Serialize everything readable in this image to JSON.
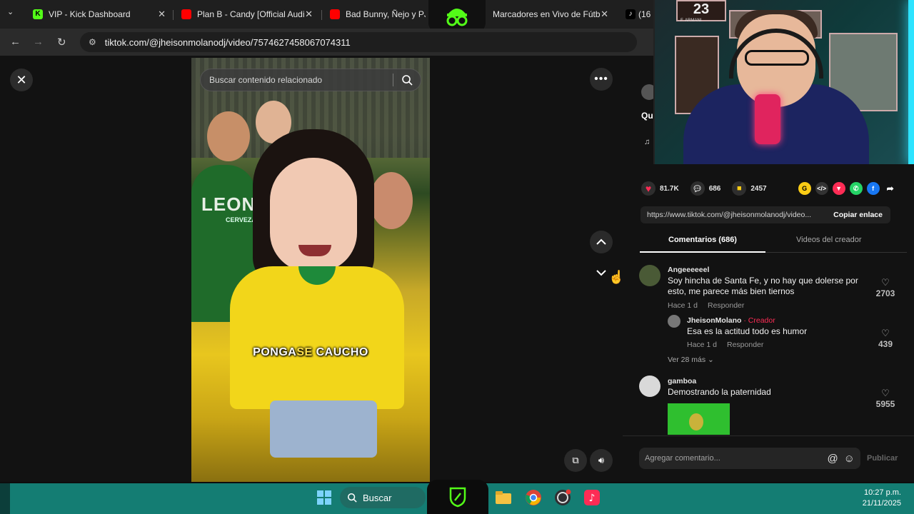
{
  "browser": {
    "tabs": [
      {
        "label": "VIP - Kick Dashboard",
        "favicon_color": "#53fc18"
      },
      {
        "label": "Plan B - Candy [Official Audi",
        "favicon_color": "#ff0000"
      },
      {
        "label": "Bad Bunny, Ñejo y PJ S",
        "favicon_color": "#ff0000"
      },
      {
        "label": "Marcadores en Vivo de Fútb",
        "favicon_color": "#1a1a1a"
      },
      {
        "label": "(16",
        "favicon_color": "#000000"
      }
    ],
    "tab_close_symbol": "✕",
    "url": "tiktok.com/@jheisonmolanodj/video/7574627458067074311"
  },
  "video": {
    "search_placeholder": "Buscar contenido relacionado",
    "caption_white": "PONGA",
    "caption_yellow": "SE",
    "caption_rest": " CAUCHO",
    "jersey_text": "LEON",
    "jersey_sub": "CERVEZA"
  },
  "webcam": {
    "shirt_number": "23",
    "frame_label": "F. ARMANI"
  },
  "stats": {
    "likes": "81.7K",
    "comments": "686",
    "saves": "2457"
  },
  "share": {
    "link": "https://www.tiktok.com/@jheisonmolanodj/video...",
    "copy_label": "Copiar enlace"
  },
  "partial_info": {
    "title_fragment": "Qu"
  },
  "tabs": {
    "comments": "Comentarios (686)",
    "creator_videos": "Videos del creador"
  },
  "comments": [
    {
      "user": "Angeeeeeel",
      "text": "Soy hincha de Santa Fe, y no hay que dolerse por esto, me parece más bien tiernos",
      "time": "Hace 1 d",
      "reply": "Responder",
      "likes": "2703"
    },
    {
      "user": "JheisonMolano",
      "badge": "· Creador",
      "text": "Esa es la actitud todo es humor",
      "time": "Hace 1 d",
      "reply": "Responder",
      "likes": "439"
    },
    {
      "user": "gamboa",
      "text": "Demostrando la paternidad",
      "likes": "5955"
    }
  ],
  "more_replies": "Ver 28 más",
  "comment_input": {
    "placeholder": "Agregar comentario...",
    "publish": "Publicar"
  },
  "taskbar": {
    "search": "Buscar",
    "time": "10:27 p.m.",
    "date": "21/11/2025"
  },
  "colors": {
    "tiktok_red": "#fe2c55",
    "creator_pink": "#fe2c55",
    "taskbar": "#147d73"
  }
}
